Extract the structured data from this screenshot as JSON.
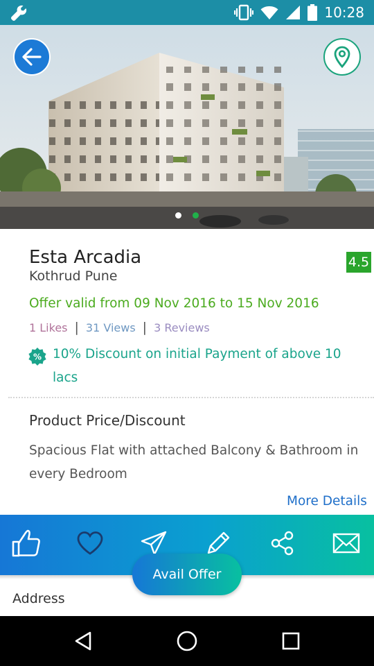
{
  "status_bar": {
    "time": "10:28",
    "icons": [
      "wrench-icon",
      "vibrate-icon",
      "wifi-icon",
      "signal-icon",
      "battery-icon"
    ]
  },
  "hero": {
    "image": "building-photo",
    "carousel_dots": 2,
    "active_dot": 2
  },
  "header_buttons": {
    "back_icon": "arrow-left-icon",
    "map_icon": "location-pin-icon"
  },
  "listing": {
    "title": "Esta Arcadia",
    "locality": "Kothrud Pune",
    "rating": "4.5",
    "offer_validity": "Offer valid from 09 Nov 2016 to 15 Nov 2016",
    "likes": "1 Likes",
    "views": "31 Views",
    "reviews": "3 Reviews",
    "separator": "|",
    "discount_text": "10% Discount on initial Payment of above 10 lacs"
  },
  "details": {
    "section_title": "Product Price/Discount",
    "description": "Spacious Flat with attached Balcony & Bathroom in every Bedroom",
    "more_link": "More Details"
  },
  "actions": {
    "items": [
      {
        "name": "like",
        "icon": "thumbs-up-icon"
      },
      {
        "name": "favorite",
        "icon": "heart-icon"
      },
      {
        "name": "send",
        "icon": "paper-plane-icon"
      },
      {
        "name": "review",
        "icon": "pencil-icon"
      },
      {
        "name": "share",
        "icon": "share-icon"
      },
      {
        "name": "message",
        "icon": "envelope-icon"
      }
    ],
    "avail_offer_label": "Avail Offer"
  },
  "address": {
    "label": "Address"
  },
  "colors": {
    "status_bar": "#1c8ea6",
    "accent_blue": "#1677d6",
    "accent_teal": "#08c0a0",
    "offer_green": "#4bab1f",
    "discount_teal": "#1aa48b",
    "rating_green": "#2aa52c",
    "link_blue": "#1f6fc9"
  },
  "nav_bar": {
    "buttons": [
      "back-triangle-icon",
      "home-circle-icon",
      "recents-square-icon"
    ]
  }
}
